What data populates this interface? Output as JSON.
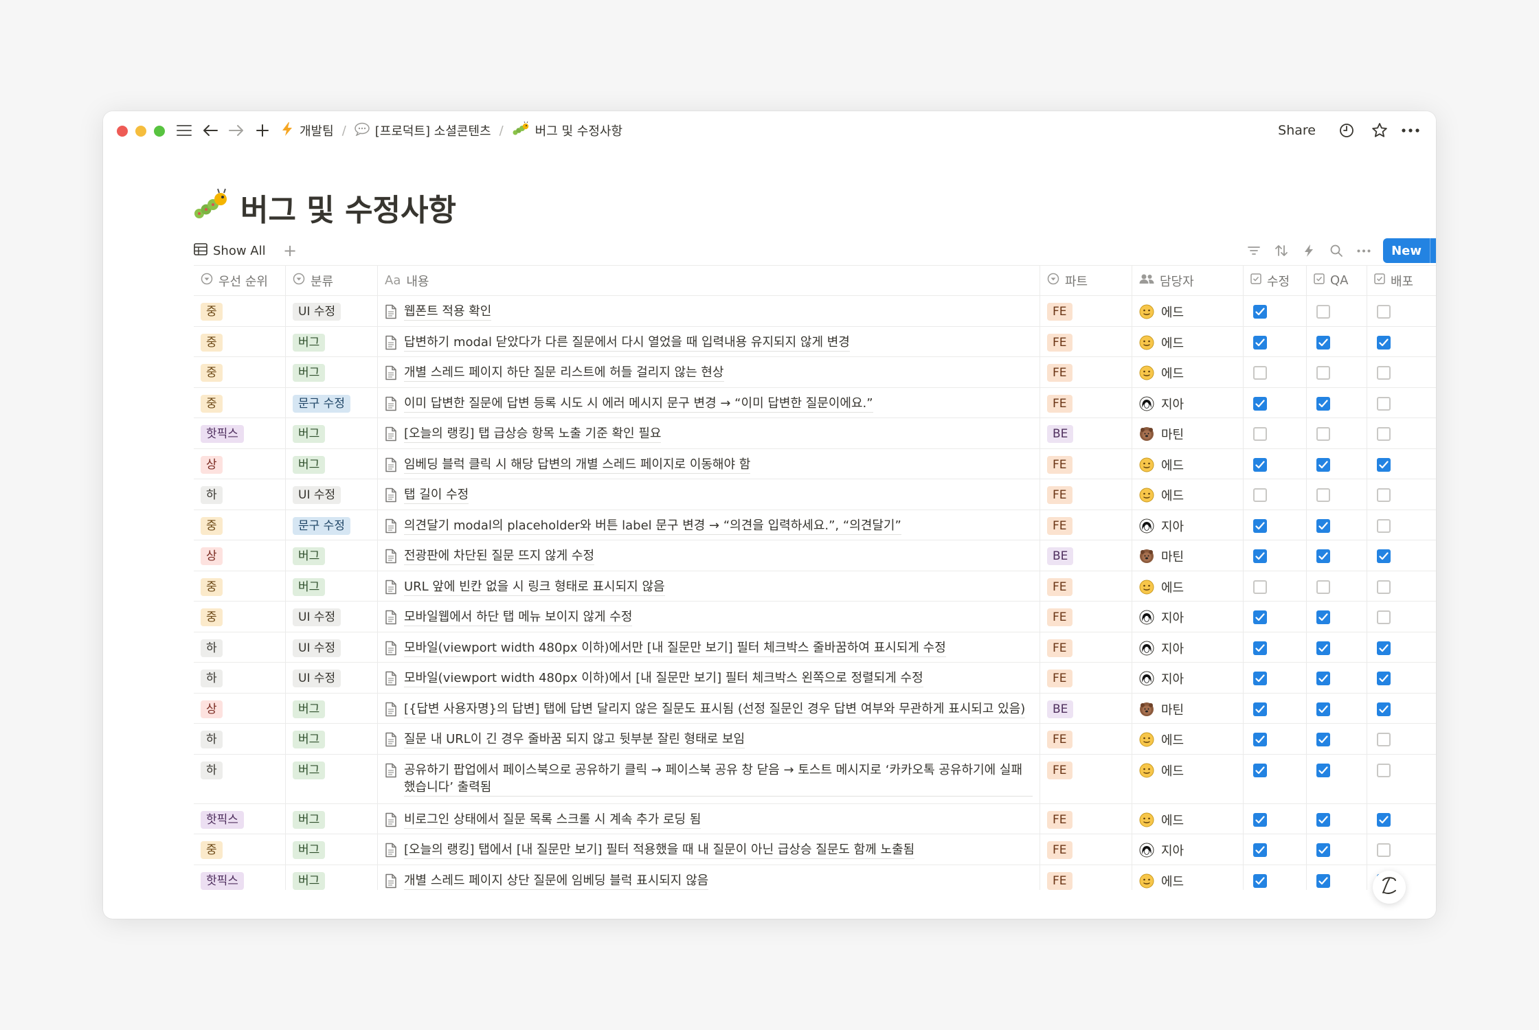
{
  "window": {
    "breadcrumbs": [
      {
        "label": "개발팀",
        "icon": "lightning-icon"
      },
      {
        "label": "[프로덕트] 소셜콘텐츠",
        "icon": "speech-bubble-icon"
      },
      {
        "label": "버그 및 수정사항",
        "icon": "caterpillar-icon"
      }
    ],
    "share_label": "Share"
  },
  "page": {
    "title": "버그 및 수정사항",
    "title_emoji": "🐛"
  },
  "view": {
    "tab_label": "Show All",
    "add_label": "+",
    "new_label": "New"
  },
  "table": {
    "headers": {
      "priority": "우선 순위",
      "category": "분류",
      "content_prefix": "Aa",
      "content": "내용",
      "part": "파트",
      "assignee": "담당자",
      "fix": "수정",
      "qa": "QA",
      "deploy": "배포"
    },
    "rows": [
      {
        "priority": "중",
        "category": "UI 수정",
        "content": "웹폰트 적용 확인",
        "part": "FE",
        "assignee": "에드",
        "fix": true,
        "qa": false,
        "deploy": false
      },
      {
        "priority": "중",
        "category": "버그",
        "content": "답변하기 modal 닫았다가 다른 질문에서 다시 열었을 때 입력내용 유지되지 않게 변경",
        "part": "FE",
        "assignee": "에드",
        "fix": true,
        "qa": true,
        "deploy": true
      },
      {
        "priority": "중",
        "category": "버그",
        "content": "개별 스레드 페이지 하단 질문 리스트에 허들 걸리지 않는 현상",
        "part": "FE",
        "assignee": "에드",
        "fix": false,
        "qa": false,
        "deploy": false
      },
      {
        "priority": "중",
        "category": "문구 수정",
        "content": "이미 답변한 질문에 답변 등록 시도 시 에러 메시지 문구 변경 → “이미 답변한 질문이에요.”",
        "part": "FE",
        "assignee": "지아",
        "fix": true,
        "qa": true,
        "deploy": false
      },
      {
        "priority": "핫픽스",
        "category": "버그",
        "content": "[오늘의 랭킹] 탭 급상승 항목 노출 기준 확인 필요",
        "part": "BE",
        "assignee": "마틴",
        "fix": false,
        "qa": false,
        "deploy": false
      },
      {
        "priority": "상",
        "category": "버그",
        "content": "임베딩 블럭 클릭 시 해당 답변의 개별 스레드 페이지로 이동해야 함",
        "part": "FE",
        "assignee": "에드",
        "fix": true,
        "qa": true,
        "deploy": true
      },
      {
        "priority": "하",
        "category": "UI 수정",
        "content": "탭 길이 수정",
        "part": "FE",
        "assignee": "에드",
        "fix": false,
        "qa": false,
        "deploy": false
      },
      {
        "priority": "중",
        "category": "문구 수정",
        "content": "의견달기 modal의 placeholder와 버튼 label 문구 변경 → “의견을 입력하세요.”, “의견달기”",
        "part": "FE",
        "assignee": "지아",
        "fix": true,
        "qa": true,
        "deploy": false
      },
      {
        "priority": "상",
        "category": "버그",
        "content": "전광판에 차단된 질문 뜨지 않게 수정",
        "part": "BE",
        "assignee": "마틴",
        "fix": true,
        "qa": true,
        "deploy": true
      },
      {
        "priority": "중",
        "category": "버그",
        "content": "URL 앞에 빈칸 없을 시 링크 형태로 표시되지 않음",
        "part": "FE",
        "assignee": "에드",
        "fix": false,
        "qa": false,
        "deploy": false
      },
      {
        "priority": "중",
        "category": "UI 수정",
        "content": "모바일웹에서 하단 탭 메뉴 보이지 않게 수정",
        "part": "FE",
        "assignee": "지아",
        "fix": true,
        "qa": true,
        "deploy": false
      },
      {
        "priority": "하",
        "category": "UI 수정",
        "content": "모바일(viewport width 480px 이하)에서만 [내 질문만 보기] 필터 체크박스 줄바꿈하여 표시되게 수정",
        "part": "FE",
        "assignee": "지아",
        "fix": true,
        "qa": true,
        "deploy": true
      },
      {
        "priority": "하",
        "category": "UI 수정",
        "content": "모바일(viewport width 480px 이하)에서 [내 질문만 보기] 필터 체크박스 왼쪽으로 정렬되게 수정",
        "part": "FE",
        "assignee": "지아",
        "fix": true,
        "qa": true,
        "deploy": true
      },
      {
        "priority": "상",
        "category": "버그",
        "content": "[{답변 사용자명}의 답변] 탭에 답변 달리지 않은 질문도 표시됨 (선정 질문인 경우 답변 여부와 무관하게 표시되고 있음)",
        "part": "BE",
        "assignee": "마틴",
        "fix": true,
        "qa": true,
        "deploy": true
      },
      {
        "priority": "하",
        "category": "버그",
        "content": "질문 내 URL이 긴 경우 줄바꿈 되지 않고 뒷부분 잘린 형태로 보임",
        "part": "FE",
        "assignee": "에드",
        "fix": true,
        "qa": true,
        "deploy": false
      },
      {
        "priority": "하",
        "category": "버그",
        "content": "공유하기 팝업에서 페이스북으로 공유하기 클릭 → 페이스북 공유 창 닫음 → 토스트 메시지로 ‘카카오톡 공유하기에 실패했습니다’ 출력됨",
        "part": "FE",
        "assignee": "에드",
        "fix": true,
        "qa": true,
        "deploy": false
      },
      {
        "priority": "핫픽스",
        "category": "버그",
        "content": "비로그인 상태에서 질문 목록 스크롤 시 계속 추가 로딩 됨",
        "part": "FE",
        "assignee": "에드",
        "fix": true,
        "qa": true,
        "deploy": true
      },
      {
        "priority": "중",
        "category": "버그",
        "content": "[오늘의 랭킹] 탭에서 [내 질문만 보기] 필터 적용했을 때 내 질문이 아닌 급상승 질문도 함께 노출됨",
        "part": "FE",
        "assignee": "지아",
        "fix": true,
        "qa": true,
        "deploy": false
      },
      {
        "priority": "핫픽스",
        "category": "버그",
        "content": "개별 스레드 페이지 상단 질문에 임베딩 블럭 표시되지 않음",
        "part": "FE",
        "assignee": "에드",
        "fix": true,
        "qa": true,
        "deploy": true
      }
    ]
  },
  "colors": {
    "priority": {
      "중": "#fbeacb",
      "상": "#fde2df",
      "하": "#ededeb",
      "핫픽스": "#ecdff2"
    },
    "priority_text": {
      "중": "#6e4a18",
      "상": "#7a2b22",
      "하": "#37352f",
      "핫픽스": "#4f2f5e"
    },
    "category": {
      "UI 수정": "#ededeb",
      "버그": "#dfeedd",
      "문구 수정": "#d6e6f3"
    },
    "category_text": {
      "UI 수정": "#37352f",
      "버그": "#2f4f2c",
      "문구 수정": "#1f4566"
    },
    "part": {
      "FE": "#fbe2cf",
      "BE": "#ede3f3"
    },
    "part_text": {
      "FE": "#6b3515",
      "BE": "#4f2f5e"
    },
    "accent": "#2383e2"
  },
  "avatars": {
    "에드": "smiley-avatar-icon",
    "지아": "bob-hair-avatar-icon",
    "마틴": "bear-avatar-icon"
  },
  "help_label": "?"
}
